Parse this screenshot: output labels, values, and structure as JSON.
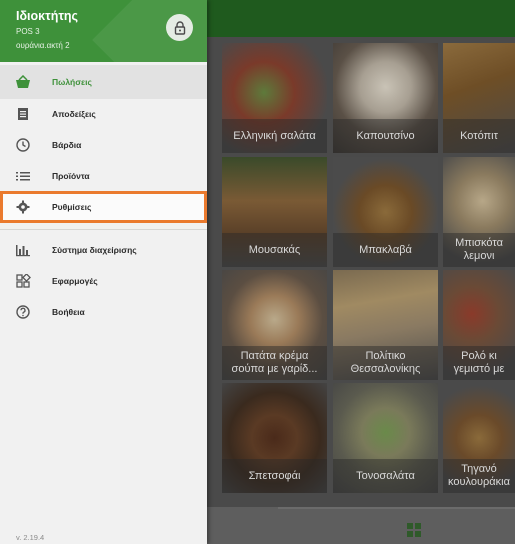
{
  "drawer": {
    "owner": "Ιδιοκτήτης",
    "pos": "POS 3",
    "shop": "ουράνια.ακτή 2",
    "menu": [
      {
        "label": "Πωλήσεις"
      },
      {
        "label": "Αποδείξεις"
      },
      {
        "label": "Βάρδια"
      },
      {
        "label": "Προϊόντα"
      },
      {
        "label": "Ρυθμίσεις"
      },
      {
        "label": "Σύστημα διαχείρισης"
      },
      {
        "label": "Εφαρμογές"
      },
      {
        "label": "Βοήθεια"
      }
    ],
    "version": "v. 2.19.4"
  },
  "products": [
    {
      "name": "Ελληνική σαλάτα"
    },
    {
      "name": "Καπουτσίνο"
    },
    {
      "name": "Κοτόπιτ"
    },
    {
      "name": "Μουσακάς"
    },
    {
      "name": "Μπακλαβά"
    },
    {
      "name": "Μπισκότα λεμονι"
    },
    {
      "name": "Πατάτα κρέμα σούπα με γαρίδ..."
    },
    {
      "name": "Πολίτικο Θεσσαλονίκης"
    },
    {
      "name": "Ρολό κι γεμιστό με"
    },
    {
      "name": ""
    },
    {
      "name": "Σπετσοφάι"
    },
    {
      "name": "Τονοσαλάτα"
    },
    {
      "name": "Τηγανό κουλουράκια"
    }
  ],
  "colors": {
    "brand": "#3e913a",
    "highlight": "#ea7a2e"
  }
}
